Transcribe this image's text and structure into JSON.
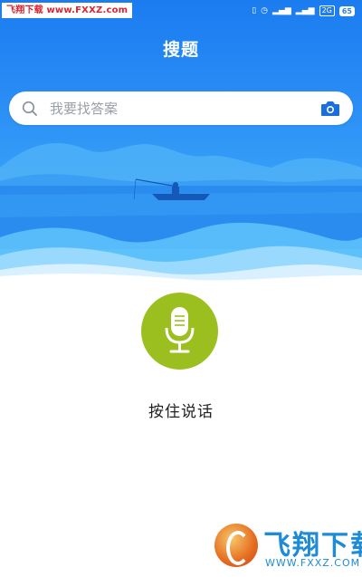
{
  "status_bar": {
    "watermark": "飞翔下载 www.FXXZ.com",
    "signal_1": "⁴ᴳ",
    "signal_2": "⁴ᴳ",
    "network": "2G",
    "battery": "65"
  },
  "header": {
    "title": "搜题"
  },
  "search": {
    "placeholder": "我要找答案",
    "value": ""
  },
  "voice": {
    "hint": "按住说话"
  },
  "watermark": {
    "brand": "飞翔下载",
    "url": "WWW.FXXZ.COM"
  },
  "colors": {
    "hero_blue": "#1b7cf0",
    "mic_green": "#9bbf1f",
    "watermark_red": "#d8262f",
    "watermark_blue": "#1d8bd6"
  }
}
